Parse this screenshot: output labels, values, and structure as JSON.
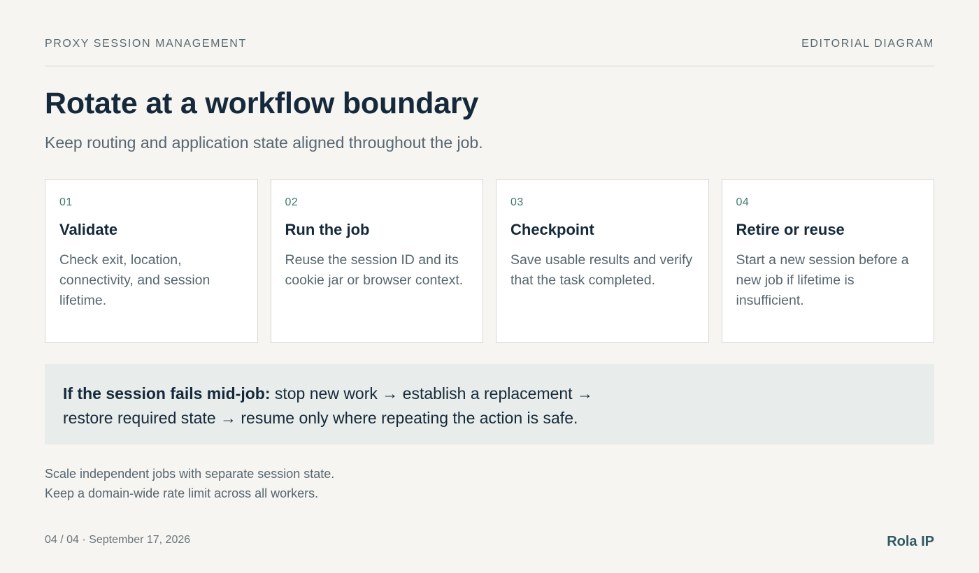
{
  "header": {
    "section_label": "PROXY SESSION MANAGEMENT",
    "kind_label": "EDITORIAL DIAGRAM"
  },
  "title": "Rotate at a workflow boundary",
  "subtitle": "Keep routing and application state aligned throughout the job.",
  "steps": [
    {
      "number": "01",
      "title": "Validate",
      "description": "Check exit, location, connectivity, and session lifetime."
    },
    {
      "number": "02",
      "title": "Run the job",
      "description": "Reuse the session ID and its cookie jar or browser context."
    },
    {
      "number": "03",
      "title": "Checkpoint",
      "description": "Save usable results and verify that the task completed."
    },
    {
      "number": "04",
      "title": "Retire or reuse",
      "description": "Start a new session before a new job if lifetime is insufficient."
    }
  ],
  "failure": {
    "lead": "If the session fails mid-job:",
    "text": " stop new work → establish a replacement → restore required state → resume only where repeating the action is safe."
  },
  "notes": {
    "line1": "Scale independent jobs with separate session state.",
    "line2": "Keep a domain-wide rate limit across all workers."
  },
  "footer": {
    "page_info": "04 / 04 · September 17, 2026",
    "brand": "Rola IP"
  }
}
